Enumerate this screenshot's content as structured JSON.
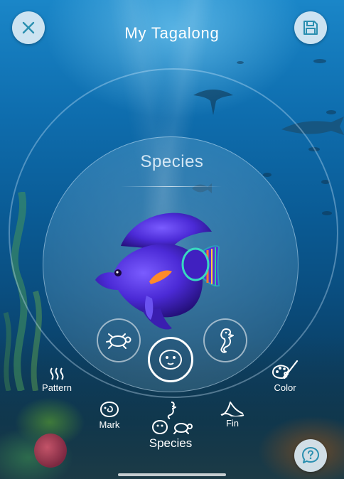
{
  "header": {
    "title": "My Tagalong",
    "close_icon": "close-icon",
    "save_icon": "save-icon"
  },
  "selector": {
    "heading": "Species",
    "options": [
      {
        "icon": "turtle-icon",
        "selected": false
      },
      {
        "icon": "fish-face-icon",
        "selected": true
      },
      {
        "icon": "seahorse-icon",
        "selected": false
      }
    ]
  },
  "categories": {
    "pattern": "Pattern",
    "color": "Color",
    "mark": "Mark",
    "fin": "Fin",
    "species": "Species"
  },
  "help": {
    "icon": "help-icon"
  },
  "colors": {
    "fish_body": "#4b2ad6",
    "fish_accent": "#ff8a2a",
    "button_bg": "#dcebf5",
    "icon_teal": "#2a8fb0"
  }
}
